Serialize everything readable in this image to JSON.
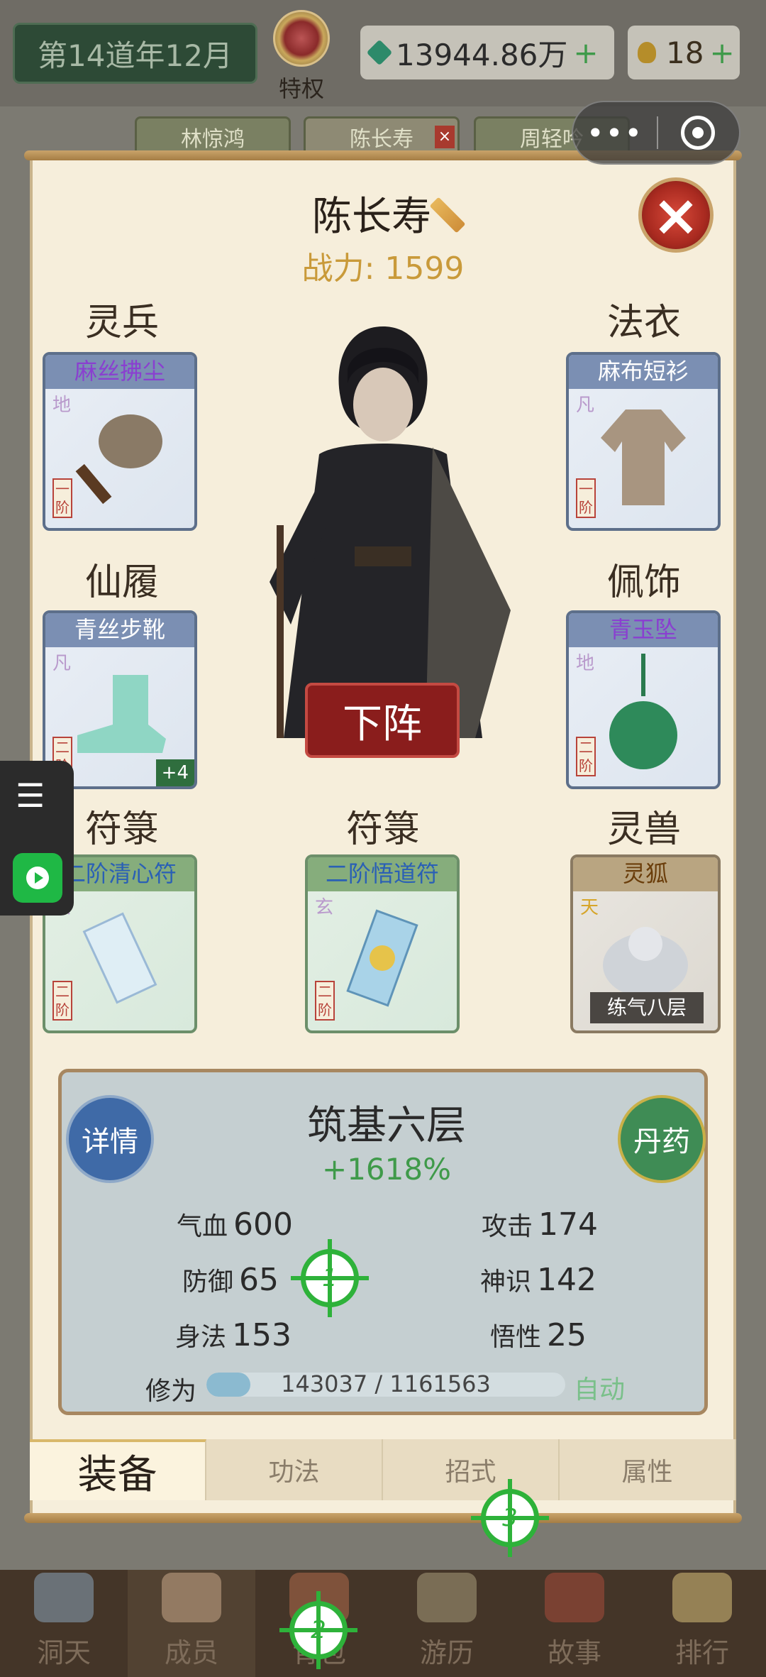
{
  "topbar": {
    "date": "第14道年12月",
    "privilege": "特权",
    "currency_amount": "13944.86万",
    "currency_plus": "+",
    "coins": "18",
    "coins_plus": "+"
  },
  "member_tabs": [
    {
      "label": "林惊鸿"
    },
    {
      "label": "陈长寿"
    },
    {
      "label": "周轻吟"
    }
  ],
  "close_x": "×",
  "capsule": {
    "more": "•••"
  },
  "character": {
    "name": "陈长寿",
    "power_label": "战力:",
    "power": "1599"
  },
  "slots": {
    "weapon": {
      "title": "灵兵",
      "item": "麻丝拂尘",
      "grade": "地",
      "tier": "一阶"
    },
    "robe": {
      "title": "法衣",
      "item": "麻布短衫",
      "grade": "凡",
      "tier": "一阶"
    },
    "boots": {
      "title": "仙履",
      "item": "青丝步靴",
      "grade": "凡",
      "tier": "二阶",
      "bonus": "+4"
    },
    "accessory": {
      "title": "佩饰",
      "item": "青玉坠",
      "grade": "地",
      "tier": "二阶"
    },
    "talisman1": {
      "title": "符箓",
      "item": "二阶清心符",
      "grade": "玄",
      "tier": "二阶"
    },
    "talisman2": {
      "title": "符箓",
      "item": "二阶悟道符",
      "grade": "玄",
      "tier": "二阶"
    },
    "beast": {
      "title": "灵兽",
      "item": "灵狐",
      "grade": "天",
      "level": "练气八层"
    }
  },
  "down_button": "下阵",
  "stats": {
    "realm": "筑基六层",
    "boost": "+1618%",
    "detail": "详情",
    "pill": "丹药",
    "hp_label": "气血",
    "hp": "600",
    "atk_label": "攻击",
    "atk": "174",
    "def_label": "防御",
    "def": "65",
    "spirit_label": "神识",
    "spirit": "142",
    "agi_label": "身法",
    "agi": "153",
    "wis_label": "悟性",
    "wis": "25",
    "xp_label": "修为",
    "xp_current": 143037,
    "xp_max": 1161563,
    "xp_text": "143037 / 1161563",
    "auto": "自动"
  },
  "bottom_tabs": [
    {
      "label": "装备"
    },
    {
      "label": "功法"
    },
    {
      "label": "招式"
    },
    {
      "label": "属性"
    }
  ],
  "markers": {
    "m1": "1",
    "m2": "2",
    "m3": "3"
  },
  "side": {
    "list_icon": "☰"
  },
  "nav": [
    {
      "label": "洞天"
    },
    {
      "label": "成员"
    },
    {
      "label": "背包"
    },
    {
      "label": "游历"
    },
    {
      "label": "故事"
    },
    {
      "label": "排行"
    }
  ],
  "colors": {
    "panel": "#f6eedb",
    "accent_green": "#3f9a4a",
    "power_gold": "#c99a3a",
    "close_red": "#a92a20"
  }
}
